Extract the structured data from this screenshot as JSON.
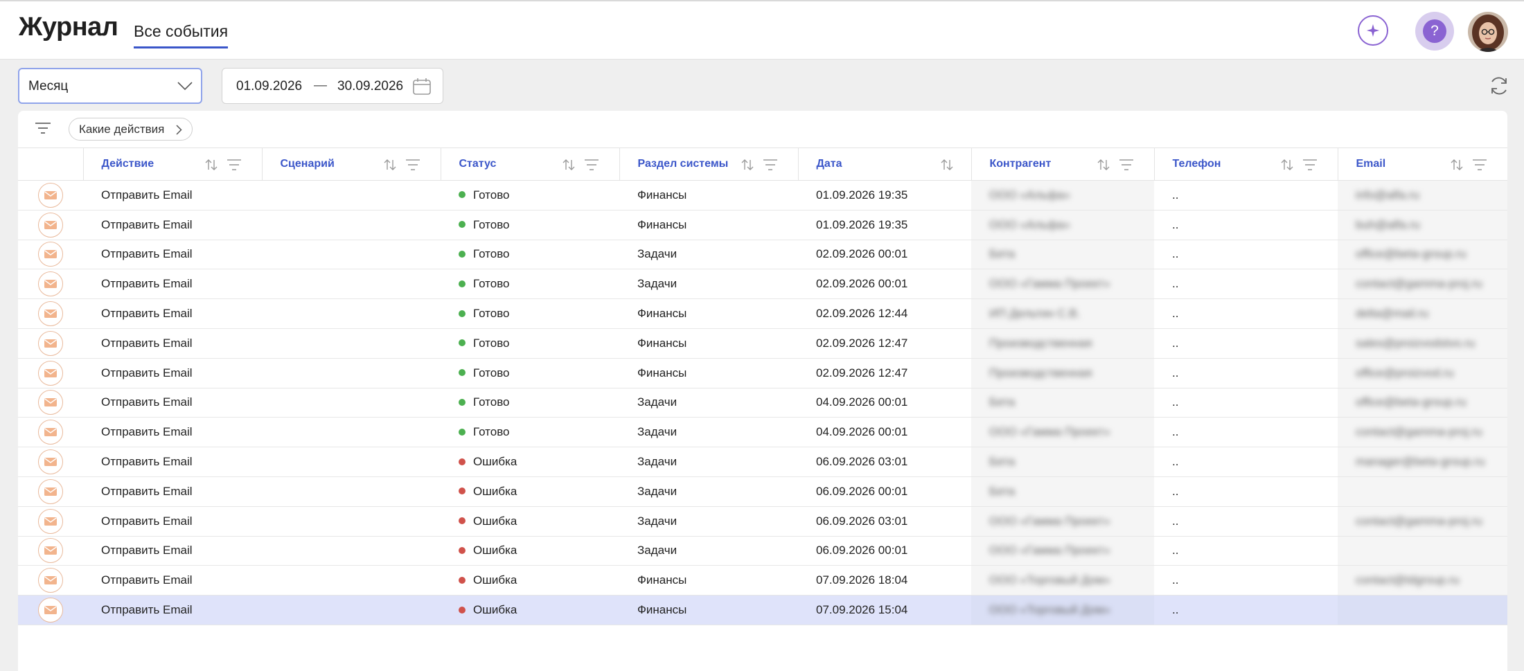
{
  "header": {
    "title": "Журнал",
    "tab": "Все события"
  },
  "filters": {
    "period": "Месяц",
    "date_from": "01.09.2026",
    "date_separator": "—",
    "date_to": "30.09.2026",
    "actions_chip": "Какие действия"
  },
  "table": {
    "columns": [
      "Действие",
      "Сценарий",
      "Статус",
      "Раздел системы",
      "Дата",
      "Контрагент",
      "Телефон",
      "Email"
    ],
    "status_colors": {
      "Готово": "#4cb050",
      "Ошибка": "#d0524b"
    },
    "rows": [
      {
        "action": "Отправить Email",
        "scenario": "",
        "status": "Готово",
        "section": "Финансы",
        "date": "01.09.2026 19:35",
        "counterparty": "ООО «Альфа»",
        "phone": "..",
        "email": "info@alfa.ru"
      },
      {
        "action": "Отправить Email",
        "scenario": "",
        "status": "Готово",
        "section": "Финансы",
        "date": "01.09.2026 19:35",
        "counterparty": "ООО «Альфа»",
        "phone": "..",
        "email": "buh@alfa.ru"
      },
      {
        "action": "Отправить Email",
        "scenario": "",
        "status": "Готово",
        "section": "Задачи",
        "date": "02.09.2026 00:01",
        "counterparty": "Бета",
        "phone": "..",
        "email": "office@beta-group.ru"
      },
      {
        "action": "Отправить Email",
        "scenario": "",
        "status": "Готово",
        "section": "Задачи",
        "date": "02.09.2026 00:01",
        "counterparty": "ООО «Гамма Проект»",
        "phone": "..",
        "email": "contact@gamma-proj.ru"
      },
      {
        "action": "Отправить Email",
        "scenario": "",
        "status": "Готово",
        "section": "Финансы",
        "date": "02.09.2026 12:44",
        "counterparty": "ИП Дельтин С.В.",
        "phone": "..",
        "email": "delta@mail.ru"
      },
      {
        "action": "Отправить Email",
        "scenario": "",
        "status": "Готово",
        "section": "Финансы",
        "date": "02.09.2026 12:47",
        "counterparty": "Производственная",
        "phone": "..",
        "email": "sales@proizvodstvo.ru"
      },
      {
        "action": "Отправить Email",
        "scenario": "",
        "status": "Готово",
        "section": "Финансы",
        "date": "02.09.2026 12:47",
        "counterparty": "Производственная",
        "phone": "..",
        "email": "office@proizvod.ru"
      },
      {
        "action": "Отправить Email",
        "scenario": "",
        "status": "Готово",
        "section": "Задачи",
        "date": "04.09.2026 00:01",
        "counterparty": "Бета",
        "phone": "..",
        "email": "office@beta-group.ru"
      },
      {
        "action": "Отправить Email",
        "scenario": "",
        "status": "Готово",
        "section": "Задачи",
        "date": "04.09.2026 00:01",
        "counterparty": "ООО «Гамма Проект»",
        "phone": "..",
        "email": "contact@gamma-proj.ru"
      },
      {
        "action": "Отправить Email",
        "scenario": "",
        "status": "Ошибка",
        "section": "Задачи",
        "date": "06.09.2026 03:01",
        "counterparty": "Бета",
        "phone": "..",
        "email": "manager@beta-group.ru"
      },
      {
        "action": "Отправить Email",
        "scenario": "",
        "status": "Ошибка",
        "section": "Задачи",
        "date": "06.09.2026 00:01",
        "counterparty": "Бета",
        "phone": "..",
        "email": ""
      },
      {
        "action": "Отправить Email",
        "scenario": "",
        "status": "Ошибка",
        "section": "Задачи",
        "date": "06.09.2026 03:01",
        "counterparty": "ООО «Гамма Проект»",
        "phone": "..",
        "email": "contact@gamma-proj.ru"
      },
      {
        "action": "Отправить Email",
        "scenario": "",
        "status": "Ошибка",
        "section": "Задачи",
        "date": "06.09.2026 00:01",
        "counterparty": "ООО «Гамма Проект»",
        "phone": "..",
        "email": ""
      },
      {
        "action": "Отправить Email",
        "scenario": "",
        "status": "Ошибка",
        "section": "Финансы",
        "date": "07.09.2026 18:04",
        "counterparty": "ООО «Торговый Дом»",
        "phone": "..",
        "email": "contact@tdgroup.ru"
      },
      {
        "action": "Отправить Email",
        "scenario": "",
        "status": "Ошибка",
        "section": "Финансы",
        "date": "07.09.2026 15:04",
        "counterparty": "ООО «Торговый Дом»",
        "phone": "..",
        "email": ""
      }
    ]
  }
}
